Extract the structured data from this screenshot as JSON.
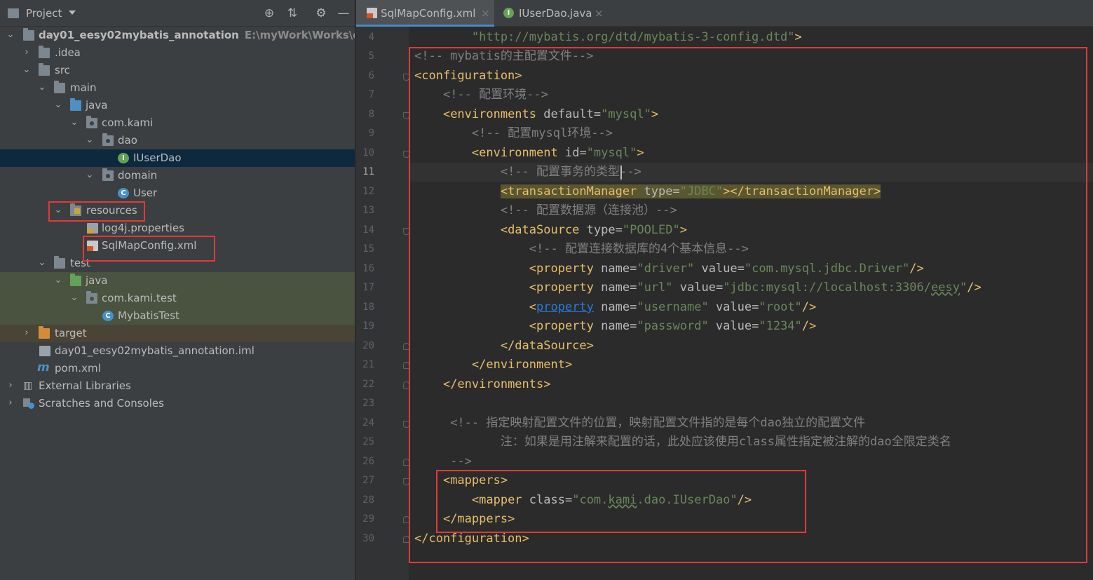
{
  "project_panel": {
    "title": "Project",
    "root_name": "day01_eesy02mybatis_annotation",
    "root_path": "E:\\myWork\\Works\\day01_",
    "items": {
      "idea": ".idea",
      "src": "src",
      "main": "main",
      "java": "java",
      "com_kami": "com.kami",
      "dao": "dao",
      "iuserdao": "IUserDao",
      "domain": "domain",
      "user": "User",
      "resources": "resources",
      "log4j": "log4j.properties",
      "sqlmapconfig": "SqlMapConfig.xml",
      "test": "test",
      "test_java": "java",
      "com_kami_test": "com.kami.test",
      "mybatistest": "MybatisTest",
      "target": "target",
      "iml": "day01_eesy02mybatis_annotation.iml",
      "pom": "pom.xml",
      "ext_libs": "External Libraries",
      "scratches": "Scratches and Consoles"
    }
  },
  "editor": {
    "tabs": [
      {
        "label": "SqlMapConfig.xml",
        "close": "×"
      },
      {
        "label": "IUserDao.java",
        "close": "×"
      }
    ],
    "line_numbers": [
      "4",
      "5",
      "6",
      "7",
      "8",
      "9",
      "10",
      "11",
      "12",
      "13",
      "14",
      "15",
      "16",
      "17",
      "18",
      "19",
      "20",
      "21",
      "22",
      "23",
      "24",
      "25",
      "26",
      "27",
      "28",
      "29",
      "30"
    ],
    "current_line": "11",
    "code": {
      "l4_val": "\"http://mybatis.org/dtd/mybatis-3-config.dtd\"",
      "l4_tag": ">",
      "l5": "<!-- mybatis的主配置文件-->",
      "l6": "<configuration>",
      "l7": "<!-- 配置环境-->",
      "l8_tag": "<environments",
      "l8_attr": " default",
      "l8_eq": "=",
      "l8_val": "\"mysql\"",
      "l8_end": ">",
      "l9": "<!-- 配置mysql环境-->",
      "l10_tag": "<environment",
      "l10_attr": " id",
      "l10_eq": "=",
      "l10_val": "\"mysql\"",
      "l10_end": ">",
      "l11": "<!-- 配置事务的类型-->",
      "l12_tag": "<transactionManager",
      "l12_attr": " type",
      "l12_eq": "=",
      "l12_val": "\"JDBC\"",
      "l12_end": "></transactionManager>",
      "l13": "<!-- 配置数据源（连接池）-->",
      "l14_tag": "<dataSource",
      "l14_attr": " type",
      "l14_eq": "=",
      "l14_val": "\"POOLED\"",
      "l14_end": ">",
      "l15": "<!-- 配置连接数据库的4个基本信息-->",
      "l16_tag": "<property",
      "l16_a1": " name",
      "l16_v1": "\"driver\"",
      "l16_a2": " value",
      "l16_v2": "\"com.mysql.jdbc.Driver\"",
      "l16_end": "/>",
      "l17_tag": "<property",
      "l17_a1": " name",
      "l17_v1": "\"url\"",
      "l17_a2": " value",
      "l17_v2a": "\"jdbc:mysql://localhost:3306/",
      "l17_v2b": "eesy",
      "l17_v2c": "\"",
      "l17_end": "/>",
      "l18_lt": "<",
      "l18_tag": "property",
      "l18_a1": " name",
      "l18_v1": "\"username\"",
      "l18_a2": " value",
      "l18_v2": "\"root\"",
      "l18_end": "/>",
      "l19_tag": "<property",
      "l19_a1": " name",
      "l19_v1": "\"password\"",
      "l19_a2": " value",
      "l19_v2": "\"1234\"",
      "l19_end": "/>",
      "l20": "</dataSource>",
      "l21": "</environment>",
      "l22": "</environments>",
      "l24": "<!-- 指定映射配置文件的位置，映射配置文件指的是每个dao独立的配置文件",
      "l25": "注：如果是用注解来配置的话，此处应该使用class属性指定被注解的dao全限定类名",
      "l26": "-->",
      "l27": "<mappers>",
      "l28_tag": "<mapper",
      "l28_attr": " class",
      "l28_eq": "=",
      "l28_va": "\"com.",
      "l28_vb": "kami",
      "l28_vc": ".dao.IUserDao\"",
      "l28_end": "/>",
      "l29": "</mappers>",
      "l30": "</configuration>",
      "eq": "="
    }
  },
  "colors": {
    "tag": "#e8bf6a",
    "attr_value": "#6a8759",
    "comment": "#808080",
    "highlight_box": "#e03a3a",
    "selection": "#0d293e"
  }
}
